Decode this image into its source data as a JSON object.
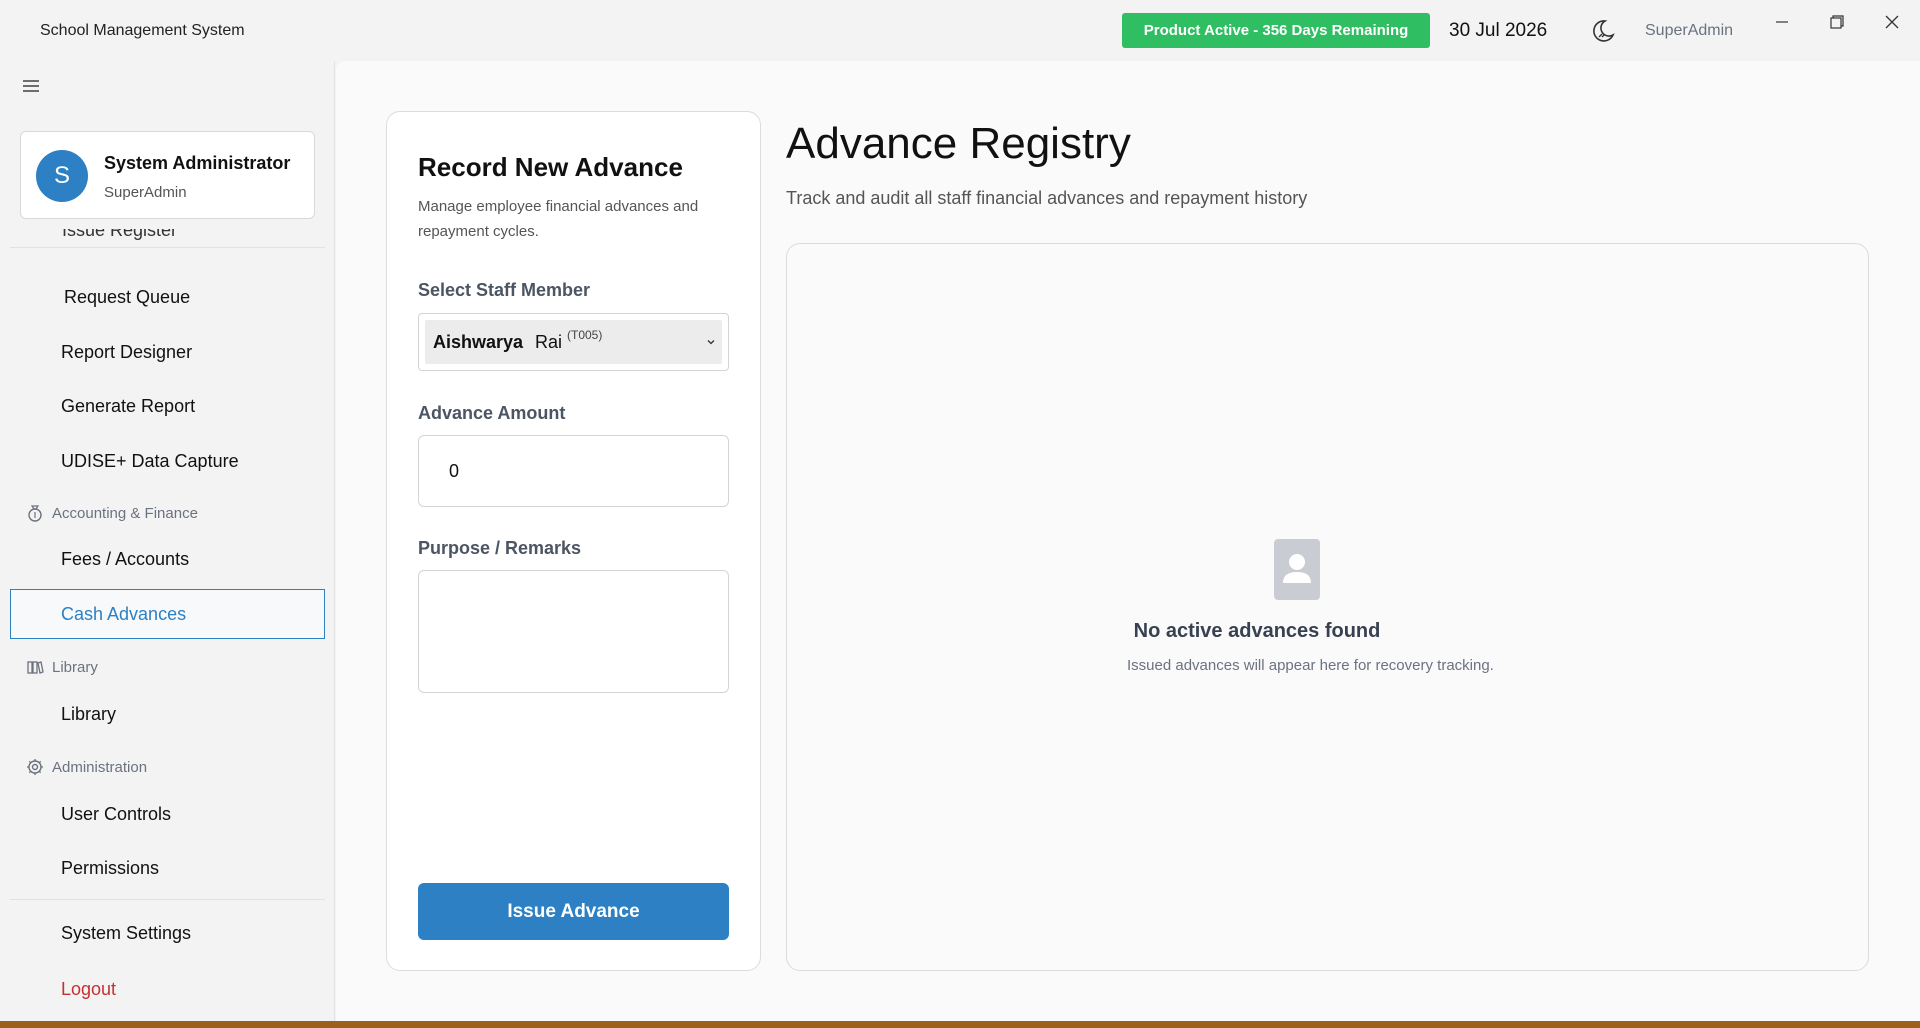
{
  "app": {
    "title": "School Management System",
    "license_badge": "Product Active - 356 Days Remaining",
    "date": "30 Jul 2026",
    "current_user": "SuperAdmin"
  },
  "sidebar": {
    "user_initial": "S",
    "user_name": "System Administrator",
    "user_role": "SuperAdmin",
    "partial_item": "Issue Register",
    "items_top": [
      {
        "label": "Request Queue"
      },
      {
        "label": "Report Designer"
      },
      {
        "label": "Generate Report"
      },
      {
        "label": "UDISE+ Data Capture"
      }
    ],
    "sections": {
      "finance": "Accounting & Finance",
      "library": "Library",
      "admin": "Administration"
    },
    "finance_items": [
      {
        "label": "Fees / Accounts"
      },
      {
        "label": "Cash Advances",
        "active": true
      }
    ],
    "library_items": [
      {
        "label": "Library"
      }
    ],
    "admin_items": [
      {
        "label": "User Controls"
      },
      {
        "label": "Permissions"
      }
    ],
    "footer_items": [
      {
        "label": "System Settings"
      },
      {
        "label": "Logout"
      }
    ]
  },
  "form": {
    "title": "Record New Advance",
    "description": "Manage employee financial advances and repayment cycles.",
    "staff_label": "Select Staff Member",
    "staff_first": "Aishwarya",
    "staff_last": "Rai",
    "staff_code": "(T005)",
    "amount_label": "Advance Amount",
    "amount_value": "0",
    "remarks_label": "Purpose / Remarks",
    "remarks_value": "",
    "submit_label": "Issue Advance"
  },
  "registry": {
    "title": "Advance Registry",
    "subtitle": "Track and audit all staff financial advances and repayment history",
    "empty_title": "No active advances found",
    "empty_desc": "Issued advances will appear here for recovery tracking."
  },
  "colors": {
    "accent": "#2c80c3",
    "badge": "#2fbf62",
    "logout": "#c53030",
    "bottom_strip": "#9c5f1c"
  },
  "icons": [
    "hamburger-icon",
    "moon-icon",
    "minimize-icon",
    "maximize-icon",
    "close-icon",
    "money-bag-icon",
    "books-icon",
    "gear-icon",
    "chevron-down-icon",
    "person-icon"
  ]
}
